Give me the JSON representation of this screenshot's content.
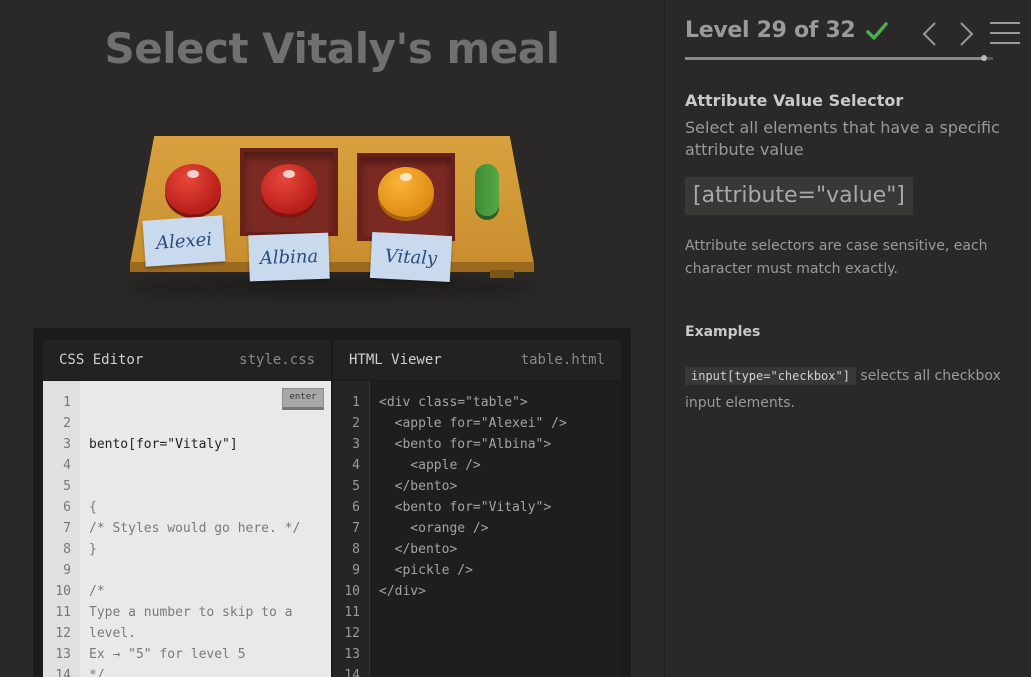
{
  "instruction": "Select Vitaly's meal",
  "table": {
    "nametags": [
      "Alexei",
      "Albina",
      "Vitaly"
    ]
  },
  "css_editor": {
    "title": "CSS Editor",
    "filename": "style.css",
    "enter_label": "enter",
    "line_numbers": [
      "1",
      "2",
      "3",
      "4",
      "5",
      "6",
      "7",
      "8",
      "9",
      "10",
      "11",
      "12",
      "13",
      "14"
    ],
    "input_value": "bento[for=\"Vitaly\"]",
    "lines": [
      "{",
      "/* Styles would go here. */",
      "}",
      "",
      "/*",
      "Type a number to skip to a",
      "level.",
      "Ex → \"5\" for level 5",
      "*/"
    ]
  },
  "html_viewer": {
    "title": "HTML Viewer",
    "filename": "table.html",
    "line_numbers": [
      "1",
      "2",
      "3",
      "4",
      "5",
      "6",
      "7",
      "8",
      "9",
      "10",
      "11",
      "12",
      "13",
      "14"
    ],
    "lines": [
      "<div class=\"table\">",
      "  <apple for=\"Alexei\" />",
      "  <bento for=\"Albina\">",
      "    <apple />",
      "  </bento>",
      "  <bento for=\"Vitaly\">",
      "    <orange />",
      "  </bento>",
      "  <pickle />",
      "</div>"
    ]
  },
  "sidebar": {
    "level_text": "Level 29 of 32",
    "progress_fraction": 0.97,
    "check_color": "#4cae4c",
    "selector_name": "Attribute Value Selector",
    "selector_title": "Select all elements that have a specific attribute value",
    "syntax": "[attribute=\"value\"]",
    "hint": "Attribute selectors are case sensitive, each character must match exactly.",
    "examples_title": "Examples",
    "example_code": "input[type=\"checkbox\"]",
    "example_text": " selects all checkbox input elements."
  }
}
